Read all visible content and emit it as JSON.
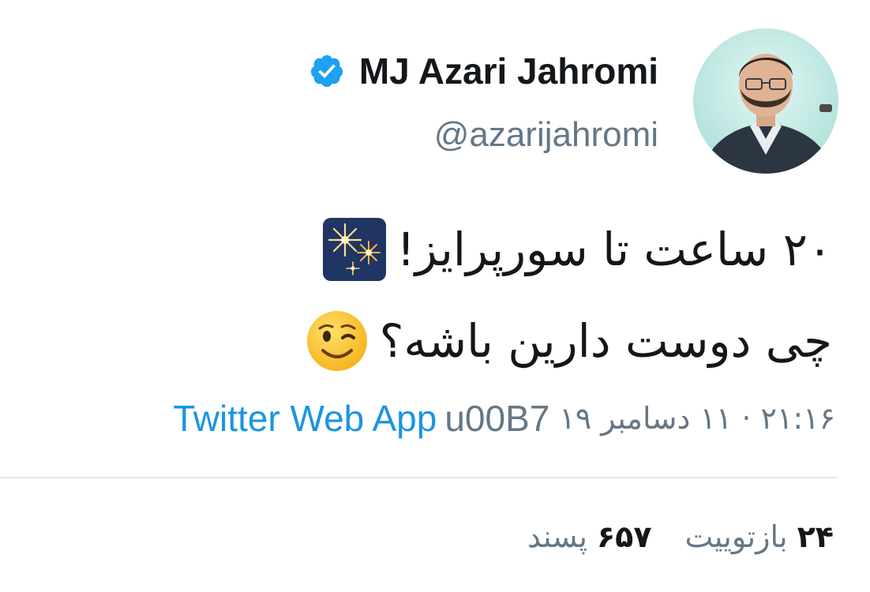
{
  "user": {
    "display_name": "MJ Azari Jahromi",
    "handle": "@azarijahromi",
    "verified": true,
    "verified_icon": "verified-badge-icon",
    "avatar_icon": "profile-photo"
  },
  "tweet": {
    "line1": "۲۰ ساعت تا سورپرایز!",
    "line1_emoji": "fireworks-emoji",
    "line2": "چی دوست دارین باشه؟",
    "line2_emoji": "winking-face-emoji"
  },
  "meta": {
    "datetime": "۲۱:۱۶ · ۱۱ دسامبر ۱۹",
    "separator": "u00B7",
    "source": "Twitter Web App"
  },
  "stats": {
    "retweets_count": "۲۴",
    "retweets_label": "بازتوییت",
    "likes_count": "۶۵۷",
    "likes_label": "پسند"
  },
  "colors": {
    "text": "#14171a",
    "muted": "#657786",
    "link": "#1b95e0",
    "verified": "#1da1f2",
    "divider": "#e1e8ed"
  }
}
